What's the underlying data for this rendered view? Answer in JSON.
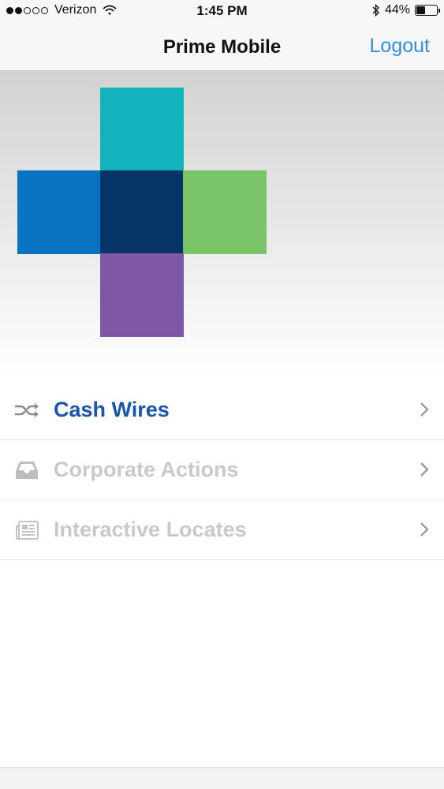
{
  "status_bar": {
    "carrier": "Verizon",
    "time": "1:45 PM",
    "battery": "44%",
    "battery_level": 0.44,
    "signal_icon": "signal-dots-icon",
    "wifi_icon": "wifi-icon",
    "bluetooth_icon": "bluetooth-icon"
  },
  "nav": {
    "title": "Prime Mobile",
    "logout_label": "Logout"
  },
  "logo": {
    "colors": {
      "top": "#13b3bb",
      "left": "#0974c1",
      "center": "#043566",
      "right": "#78c467",
      "bottom": "#7e57a6"
    }
  },
  "menu": {
    "items": [
      {
        "label": "Cash Wires",
        "icon": "shuffle-icon",
        "color": "#1a56a8",
        "enabled": true
      },
      {
        "label": "Corporate Actions",
        "icon": "inbox-tray-icon",
        "color": "#c9c9c9",
        "enabled": false
      },
      {
        "label": "Interactive Locates",
        "icon": "newspaper-icon",
        "color": "#c9c9c9",
        "enabled": false
      }
    ]
  }
}
